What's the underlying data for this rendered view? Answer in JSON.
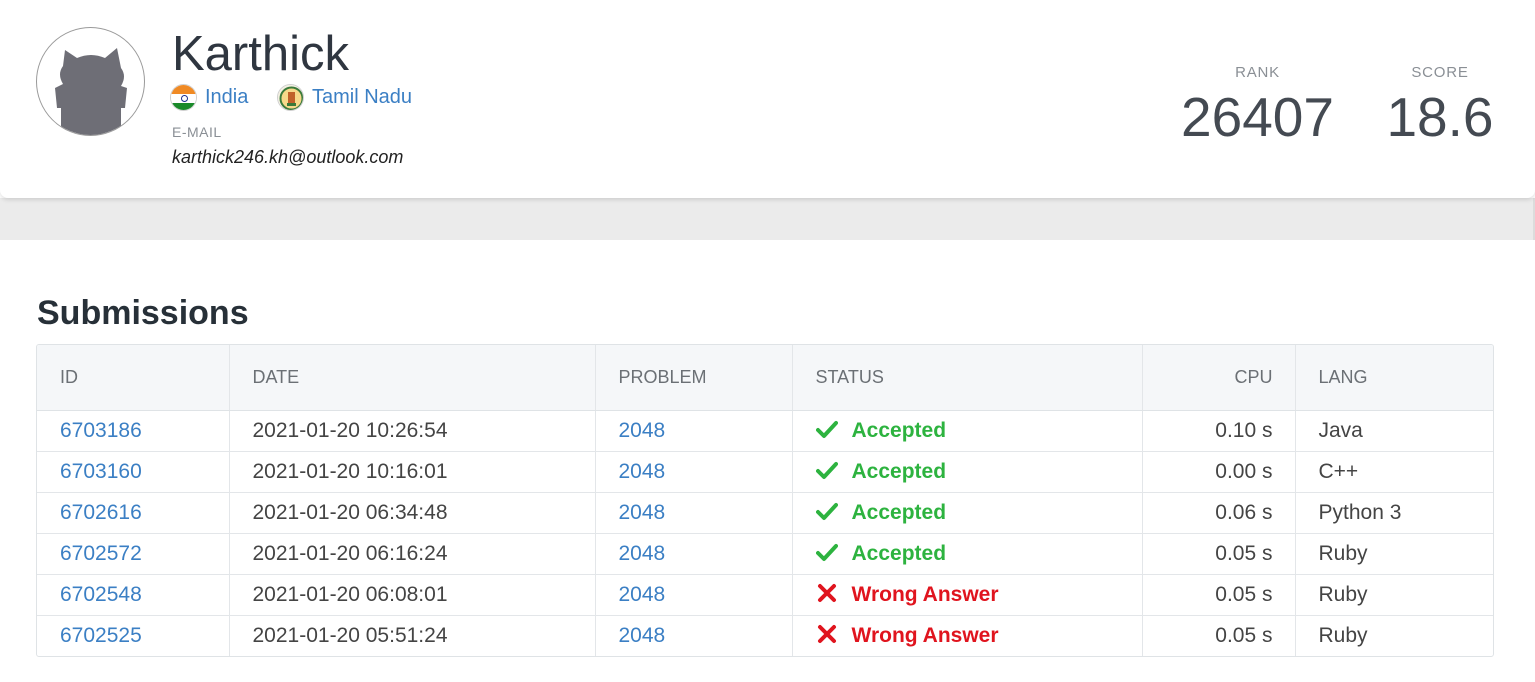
{
  "profile": {
    "name": "Karthick",
    "country": "India",
    "region": "Tamil Nadu",
    "email_label": "E-MAIL",
    "email": "karthick246.kh@outlook.com",
    "rank_label": "RANK",
    "rank": "26407",
    "score_label": "SCORE",
    "score": "18.6"
  },
  "submissions": {
    "title": "Submissions",
    "headers": {
      "id": "ID",
      "date": "DATE",
      "problem": "PROBLEM",
      "status": "STATUS",
      "cpu": "CPU",
      "lang": "LANG"
    },
    "rows": [
      {
        "id": "6703186",
        "date": "2021-01-20 10:26:54",
        "problem": "2048",
        "status": "Accepted",
        "cpu": "0.10 s",
        "lang": "Java"
      },
      {
        "id": "6703160",
        "date": "2021-01-20 10:16:01",
        "problem": "2048",
        "status": "Accepted",
        "cpu": "0.00 s",
        "lang": "C++"
      },
      {
        "id": "6702616",
        "date": "2021-01-20 06:34:48",
        "problem": "2048",
        "status": "Accepted",
        "cpu": "0.06 s",
        "lang": "Python 3"
      },
      {
        "id": "6702572",
        "date": "2021-01-20 06:16:24",
        "problem": "2048",
        "status": "Accepted",
        "cpu": "0.05 s",
        "lang": "Ruby"
      },
      {
        "id": "6702548",
        "date": "2021-01-20 06:08:01",
        "problem": "2048",
        "status": "Wrong Answer",
        "cpu": "0.05 s",
        "lang": "Ruby"
      },
      {
        "id": "6702525",
        "date": "2021-01-20 05:51:24",
        "problem": "2048",
        "status": "Wrong Answer",
        "cpu": "0.05 s",
        "lang": "Ruby"
      }
    ]
  },
  "icons": {
    "avatar": "default-avatar-icon",
    "country_flag": "india-flag-icon",
    "region_flag": "tamil-nadu-emblem-icon",
    "accepted": "checkmark-icon",
    "wrong": "cross-icon"
  },
  "colors": {
    "link": "#3b7fc4",
    "accepted": "#2db33f",
    "wrong": "#e0141e"
  }
}
